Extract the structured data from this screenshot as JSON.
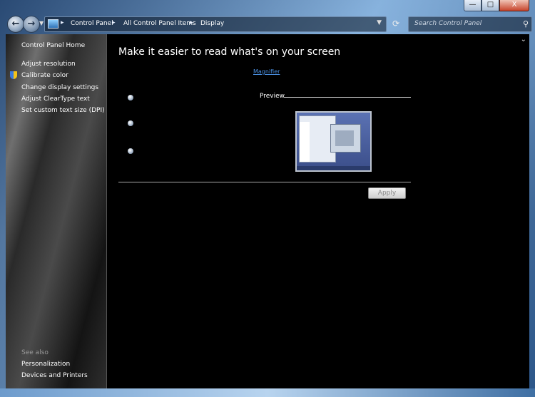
{
  "window": {
    "minimize_glyph": "—",
    "maximize_glyph": "□",
    "close_glyph": "X"
  },
  "navbar": {
    "back_glyph": "←",
    "forward_glyph": "→",
    "breadcrumbs": [
      "Control Panel",
      "All Control Panel Items",
      "Display"
    ],
    "search_placeholder": "Search Control Panel"
  },
  "sidebar": {
    "home": "Control Panel Home",
    "tasks": [
      "Adjust resolution",
      "Calibrate color",
      "Change display settings",
      "Adjust ClearType text",
      "Set custom text size (DPI)"
    ],
    "see_also_heading": "See also",
    "see_also": [
      "Personalization",
      "Devices and Printers"
    ]
  },
  "main": {
    "title": "Make it easier to read what's on your screen",
    "magnifier_link": "Magnifier",
    "preview_label": "Preview",
    "apply_label": "Apply"
  },
  "colors": {
    "content_bg": "#000000",
    "link": "#4a8fe0"
  }
}
